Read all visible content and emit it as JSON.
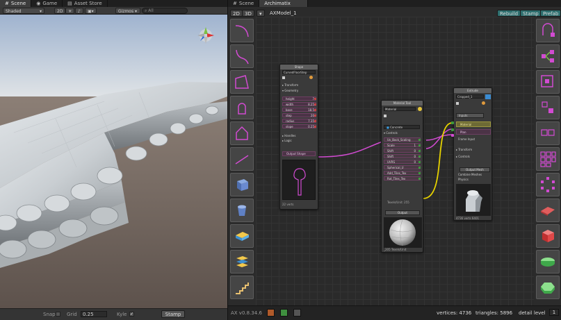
{
  "scene_panel": {
    "tabs": [
      "Scene",
      "Game",
      "Asset Store"
    ],
    "shading": "Shaded",
    "mode_2d": "2D",
    "gizmos": "Gizmos",
    "search_placeholder": "All",
    "snap_label": "Snap",
    "grid_label": "Grid",
    "grid_value": "0.25",
    "kyle_label": "Kyle",
    "stamp_button": "Stamp"
  },
  "archimatix_panel": {
    "tabs": [
      "Scene",
      "Archimatix"
    ],
    "view_2d": "2D",
    "view_3d": "3D",
    "model_name": "AXModel_1",
    "rebuild": "Rebuild",
    "stamp": "Stamp",
    "prefab": "Prefab",
    "version": "AX v0.8.34.6",
    "vertices_label": "vertices",
    "vertices_value": "4736",
    "triangles_label": "triangles:",
    "triangles_value": "5896",
    "detail_label": "detail level",
    "detail_value": "1"
  },
  "nodes": {
    "shape": {
      "title": "Shape",
      "name": "CurvedFloorStep",
      "transform": "Transform",
      "geometry": "Geometry",
      "params": [
        {
          "label": "height",
          "value": "7"
        },
        {
          "label": "width",
          "value": "8.25"
        },
        {
          "label": "base",
          "value": "18.5"
        },
        {
          "label": "step",
          "value": "20"
        },
        {
          "label": "radius",
          "value": "7.35"
        },
        {
          "label": "slope",
          "value": "0.25"
        }
      ],
      "handles": "Handles",
      "logic": "Logic",
      "output": "Output Shape",
      "footer": "22 verts"
    },
    "material": {
      "title": "Material Tool",
      "name": "Material",
      "texture": "Concrete",
      "controls": "Controls",
      "params": [
        {
          "label": "Uv_Back_Scaling",
          "value": ""
        },
        {
          "label": "Scale",
          "value": "1"
        },
        {
          "label": "Shift",
          "value": "0"
        },
        {
          "label": "Shift",
          "value": "0"
        },
        {
          "label": "UVRS",
          "value": "0"
        },
        {
          "label": "Spherical_U",
          "value": ""
        },
        {
          "label": "Add_Tiles_Tex",
          "value": ""
        },
        {
          "label": "Rot_Tiles_Tex",
          "value": ""
        }
      ],
      "texel_label": "Texels/Unit: 255",
      "output": "Output",
      "footer": "_205 Texels/Unit"
    },
    "extrude": {
      "title": "Extrude",
      "name": "Cropped_1",
      "inputs_label": "Inputs",
      "material_label": "Material",
      "plan_label": "Plan",
      "frame_input": "Frame Input",
      "transform": "Transform",
      "controls": "Controls",
      "output_mesh": "Output Mesh",
      "combine": "Combine Meshes",
      "physics": "Physics",
      "footer": "4736 verts  6401"
    }
  },
  "colors": {
    "accent_magenta": "#d24bd2",
    "wire_yellow": "#e6d200",
    "rebuild_teal": "#2e6e6e"
  }
}
